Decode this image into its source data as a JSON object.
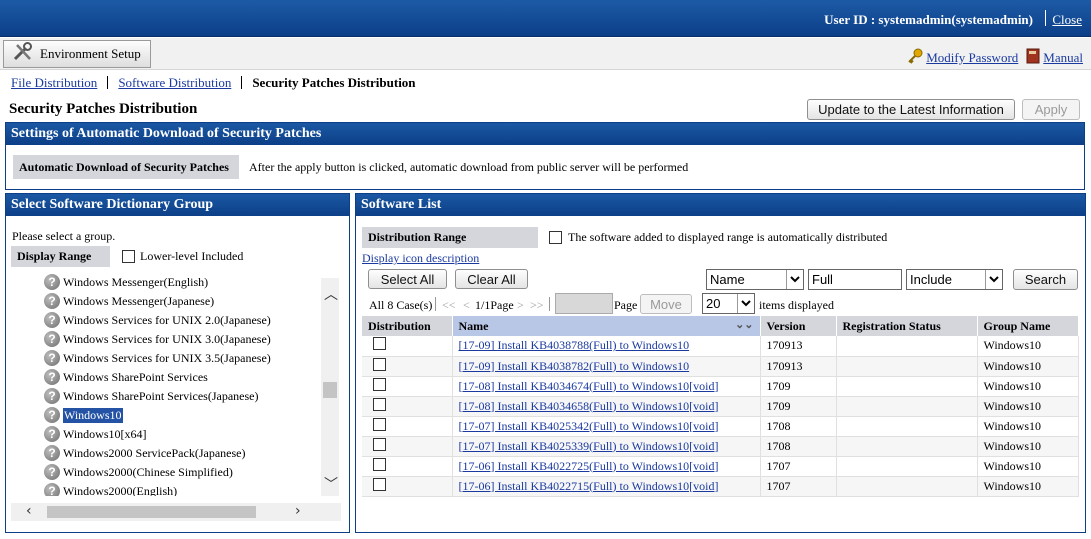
{
  "header": {
    "user_id": "User ID : systemadmin(systemadmin)",
    "close": "Close"
  },
  "menubar": {
    "env_setup": "Environment Setup",
    "modify_password": "Modify Password",
    "manual": "Manual"
  },
  "breadcrumb": {
    "file_dist": "File Distribution",
    "software_dist": "Software Distribution",
    "current": "Security Patches Distribution"
  },
  "page": {
    "title": "Security Patches Distribution",
    "update_btn": "Update to the Latest Information",
    "apply_btn": "Apply"
  },
  "auto_download": {
    "header": "Settings of Automatic Download of Security Patches",
    "label": "Automatic Download of Security Patches",
    "value": "After the apply button is clicked, automatic download from public server will be performed"
  },
  "dictionary": {
    "header": "Select Software Dictionary Group",
    "prompt": "Please select a group.",
    "display_range_label": "Display Range",
    "lower_level": "Lower-level Included",
    "selected_index": 7,
    "items": [
      "Windows Messenger(English)",
      "Windows Messenger(Japanese)",
      "Windows Services for UNIX 2.0(Japanese)",
      "Windows Services for UNIX 3.0(Japanese)",
      "Windows Services for UNIX 3.5(Japanese)",
      "Windows SharePoint Services",
      "Windows SharePoint Services(Japanese)",
      "Windows10",
      "Windows10[x64]",
      "Windows2000 ServicePack(Japanese)",
      "Windows2000(Chinese Simplified)",
      "Windows2000(English)"
    ]
  },
  "software": {
    "header": "Software List",
    "dist_range_label": "Distribution Range",
    "auto_dist_text": "The software added to displayed range is automatically distributed",
    "icon_desc_link": "Display icon description",
    "select_all": "Select All",
    "clear_all": "Clear All",
    "filter_field": "Name",
    "filter_value": "Full",
    "filter_mode": "Include",
    "search_btn": "Search",
    "case_count": "All 8 Case(s)",
    "first": "<<",
    "prev": "<",
    "page_info": "1/1Page",
    "next": ">",
    "last": ">>",
    "page_label": "Page",
    "move_btn": "Move",
    "per_page": "20",
    "items_displayed": "items displayed",
    "columns": {
      "distribution": "Distribution",
      "name": "Name",
      "version": "Version",
      "status": "Registration Status",
      "group": "Group Name"
    },
    "rows": [
      {
        "name": "[17-09] Install KB4038788(Full) to Windows10",
        "version": "170913",
        "status": "",
        "group": "Windows10"
      },
      {
        "name": "[17-09] Install KB4038782(Full) to Windows10",
        "version": "170913",
        "status": "",
        "group": "Windows10"
      },
      {
        "name": "[17-08] Install KB4034674(Full) to Windows10[void]",
        "version": "1709",
        "status": "",
        "group": "Windows10"
      },
      {
        "name": "[17-08] Install KB4034658(Full) to Windows10[void]",
        "version": "1709",
        "status": "",
        "group": "Windows10"
      },
      {
        "name": "[17-07] Install KB4025342(Full) to Windows10[void]",
        "version": "1708",
        "status": "",
        "group": "Windows10"
      },
      {
        "name": "[17-07] Install KB4025339(Full) to Windows10[void]",
        "version": "1708",
        "status": "",
        "group": "Windows10"
      },
      {
        "name": "[17-06] Install KB4022725(Full) to Windows10[void]",
        "version": "1707",
        "status": "",
        "group": "Windows10"
      },
      {
        "name": "[17-06] Install KB4022715(Full) to Windows10[void]",
        "version": "1707",
        "status": "",
        "group": "Windows10"
      }
    ]
  }
}
